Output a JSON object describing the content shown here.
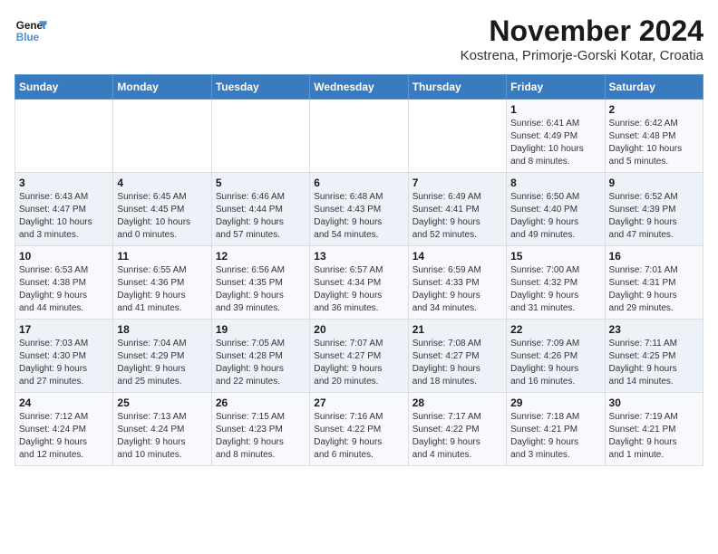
{
  "logo": {
    "line1": "General",
    "line2": "Blue"
  },
  "title": "November 2024",
  "subtitle": "Kostrena, Primorje-Gorski Kotar, Croatia",
  "weekdays": [
    "Sunday",
    "Monday",
    "Tuesday",
    "Wednesday",
    "Thursday",
    "Friday",
    "Saturday"
  ],
  "weeks": [
    [
      {
        "day": "",
        "info": ""
      },
      {
        "day": "",
        "info": ""
      },
      {
        "day": "",
        "info": ""
      },
      {
        "day": "",
        "info": ""
      },
      {
        "day": "",
        "info": ""
      },
      {
        "day": "1",
        "info": "Sunrise: 6:41 AM\nSunset: 4:49 PM\nDaylight: 10 hours\nand 8 minutes."
      },
      {
        "day": "2",
        "info": "Sunrise: 6:42 AM\nSunset: 4:48 PM\nDaylight: 10 hours\nand 5 minutes."
      }
    ],
    [
      {
        "day": "3",
        "info": "Sunrise: 6:43 AM\nSunset: 4:47 PM\nDaylight: 10 hours\nand 3 minutes."
      },
      {
        "day": "4",
        "info": "Sunrise: 6:45 AM\nSunset: 4:45 PM\nDaylight: 10 hours\nand 0 minutes."
      },
      {
        "day": "5",
        "info": "Sunrise: 6:46 AM\nSunset: 4:44 PM\nDaylight: 9 hours\nand 57 minutes."
      },
      {
        "day": "6",
        "info": "Sunrise: 6:48 AM\nSunset: 4:43 PM\nDaylight: 9 hours\nand 54 minutes."
      },
      {
        "day": "7",
        "info": "Sunrise: 6:49 AM\nSunset: 4:41 PM\nDaylight: 9 hours\nand 52 minutes."
      },
      {
        "day": "8",
        "info": "Sunrise: 6:50 AM\nSunset: 4:40 PM\nDaylight: 9 hours\nand 49 minutes."
      },
      {
        "day": "9",
        "info": "Sunrise: 6:52 AM\nSunset: 4:39 PM\nDaylight: 9 hours\nand 47 minutes."
      }
    ],
    [
      {
        "day": "10",
        "info": "Sunrise: 6:53 AM\nSunset: 4:38 PM\nDaylight: 9 hours\nand 44 minutes."
      },
      {
        "day": "11",
        "info": "Sunrise: 6:55 AM\nSunset: 4:36 PM\nDaylight: 9 hours\nand 41 minutes."
      },
      {
        "day": "12",
        "info": "Sunrise: 6:56 AM\nSunset: 4:35 PM\nDaylight: 9 hours\nand 39 minutes."
      },
      {
        "day": "13",
        "info": "Sunrise: 6:57 AM\nSunset: 4:34 PM\nDaylight: 9 hours\nand 36 minutes."
      },
      {
        "day": "14",
        "info": "Sunrise: 6:59 AM\nSunset: 4:33 PM\nDaylight: 9 hours\nand 34 minutes."
      },
      {
        "day": "15",
        "info": "Sunrise: 7:00 AM\nSunset: 4:32 PM\nDaylight: 9 hours\nand 31 minutes."
      },
      {
        "day": "16",
        "info": "Sunrise: 7:01 AM\nSunset: 4:31 PM\nDaylight: 9 hours\nand 29 minutes."
      }
    ],
    [
      {
        "day": "17",
        "info": "Sunrise: 7:03 AM\nSunset: 4:30 PM\nDaylight: 9 hours\nand 27 minutes."
      },
      {
        "day": "18",
        "info": "Sunrise: 7:04 AM\nSunset: 4:29 PM\nDaylight: 9 hours\nand 25 minutes."
      },
      {
        "day": "19",
        "info": "Sunrise: 7:05 AM\nSunset: 4:28 PM\nDaylight: 9 hours\nand 22 minutes."
      },
      {
        "day": "20",
        "info": "Sunrise: 7:07 AM\nSunset: 4:27 PM\nDaylight: 9 hours\nand 20 minutes."
      },
      {
        "day": "21",
        "info": "Sunrise: 7:08 AM\nSunset: 4:27 PM\nDaylight: 9 hours\nand 18 minutes."
      },
      {
        "day": "22",
        "info": "Sunrise: 7:09 AM\nSunset: 4:26 PM\nDaylight: 9 hours\nand 16 minutes."
      },
      {
        "day": "23",
        "info": "Sunrise: 7:11 AM\nSunset: 4:25 PM\nDaylight: 9 hours\nand 14 minutes."
      }
    ],
    [
      {
        "day": "24",
        "info": "Sunrise: 7:12 AM\nSunset: 4:24 PM\nDaylight: 9 hours\nand 12 minutes."
      },
      {
        "day": "25",
        "info": "Sunrise: 7:13 AM\nSunset: 4:24 PM\nDaylight: 9 hours\nand 10 minutes."
      },
      {
        "day": "26",
        "info": "Sunrise: 7:15 AM\nSunset: 4:23 PM\nDaylight: 9 hours\nand 8 minutes."
      },
      {
        "day": "27",
        "info": "Sunrise: 7:16 AM\nSunset: 4:22 PM\nDaylight: 9 hours\nand 6 minutes."
      },
      {
        "day": "28",
        "info": "Sunrise: 7:17 AM\nSunset: 4:22 PM\nDaylight: 9 hours\nand 4 minutes."
      },
      {
        "day": "29",
        "info": "Sunrise: 7:18 AM\nSunset: 4:21 PM\nDaylight: 9 hours\nand 3 minutes."
      },
      {
        "day": "30",
        "info": "Sunrise: 7:19 AM\nSunset: 4:21 PM\nDaylight: 9 hours\nand 1 minute."
      }
    ]
  ]
}
